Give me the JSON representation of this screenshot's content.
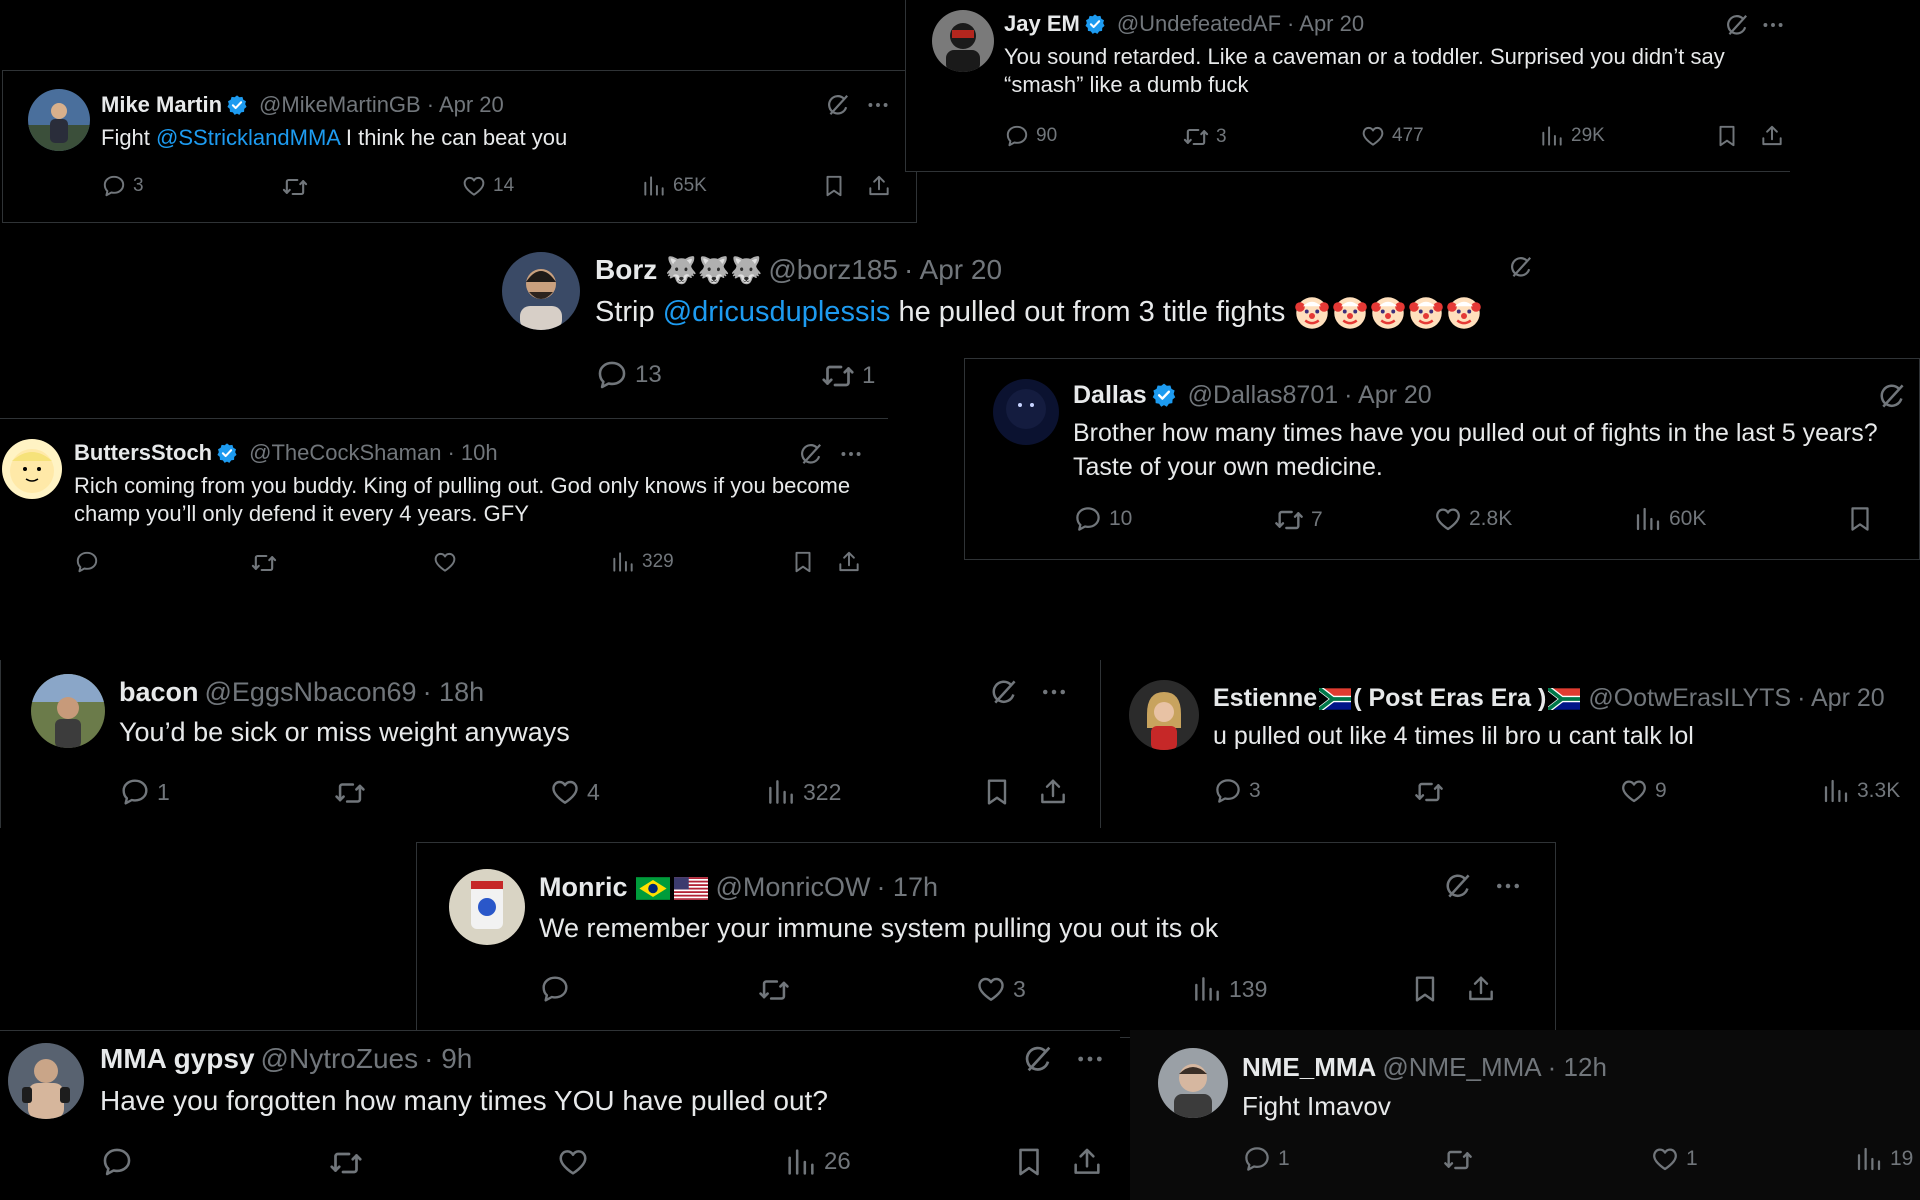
{
  "tweets": {
    "mike": {
      "name": "Mike Martin",
      "handle": "@MikeMartinGB",
      "date": "· Apr 20",
      "text_pre": "Fight ",
      "mention": "@SStricklandMMA",
      "text_post": " I think he can beat you",
      "replies": "3",
      "reposts": "",
      "likes": "14",
      "views": "65K"
    },
    "jay": {
      "name": "Jay EM",
      "handle": "@UndefeatedAF",
      "date": "· Apr 20",
      "text": "You sound retarded. Like a caveman or a toddler. Surprised you didn’t say “smash” like a dumb fuck",
      "replies": "90",
      "reposts": "3",
      "likes": "477",
      "views": "29K"
    },
    "borz": {
      "name": "Borz",
      "handle": "@borz185",
      "date": "· Apr 20",
      "text_pre": "Strip ",
      "mention": "@dricusduplessis",
      "text_post": " he pulled out from 3 title fights",
      "replies": "13",
      "reposts": "1"
    },
    "dallas": {
      "name": "Dallas",
      "handle": "@Dallas8701",
      "date": "· Apr 20",
      "text": "Brother how many times have you pulled out of fights in the last 5 years? Taste of your own medicine.",
      "replies": "10",
      "reposts": "7",
      "likes": "2.8K",
      "views": "60K"
    },
    "butters": {
      "name": "ButtersStoch",
      "handle": "@TheCockShaman",
      "date": "· 10h",
      "text": "Rich coming from you buddy. King of pulling out. God only knows if you become champ you’ll only defend it every 4 years. GFY",
      "replies": "",
      "reposts": "",
      "likes": "",
      "views": "329"
    },
    "bacon": {
      "name": "bacon",
      "handle": "@EggsNbacon69",
      "date": "· 18h",
      "text": "You’d be sick or miss weight anyways",
      "replies": "1",
      "reposts": "",
      "likes": "4",
      "views": "322"
    },
    "estienne": {
      "name_pre": "Estienne",
      "name_mid": "( Post Eras Era )",
      "handle": "@OotwErasILYTS",
      "date": "· Apr 20",
      "text": "u pulled out like 4 times lil bro u cant talk lol",
      "replies": "3",
      "reposts": "",
      "likes": "9",
      "views": "3.3K"
    },
    "monric": {
      "name": "Monric",
      "handle": "@MonricOW",
      "date": "· 17h",
      "text": "We remember your immune system pulling you out its ok",
      "replies": "",
      "reposts": "",
      "likes": "3",
      "views": "139"
    },
    "gypsy": {
      "name": "MMA gypsy",
      "handle": "@NytroZues",
      "date": "· 9h",
      "text": "Have you forgotten how many times YOU have pulled out?",
      "replies": "",
      "reposts": "",
      "likes": "",
      "views": "26"
    },
    "nme": {
      "name": "NME_MMA",
      "handle": "@NME_MMA",
      "date": "· 12h",
      "text": "Fight Imavov",
      "replies": "1",
      "reposts": "",
      "likes": "1",
      "views": "19"
    }
  },
  "colors": {
    "bg": "#000000",
    "text": "#e7e9ea",
    "muted": "#71767b",
    "accent": "#1d9bf0",
    "border": "#2f3336"
  },
  "icons": [
    "reply-icon",
    "repost-icon",
    "like-icon",
    "views-icon",
    "bookmark-icon",
    "share-icon",
    "grok-icon",
    "more-icon",
    "verified-icon",
    "clown-emoji",
    "south-africa-flag",
    "brazil-flag",
    "usa-flag"
  ]
}
